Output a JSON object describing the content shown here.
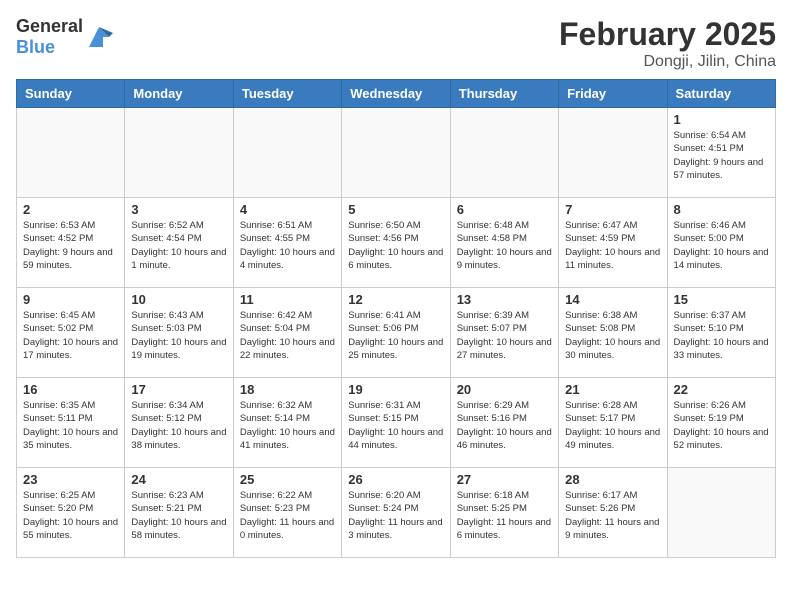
{
  "header": {
    "logo_general": "General",
    "logo_blue": "Blue",
    "title": "February 2025",
    "subtitle": "Dongji, Jilin, China"
  },
  "weekdays": [
    "Sunday",
    "Monday",
    "Tuesday",
    "Wednesday",
    "Thursday",
    "Friday",
    "Saturday"
  ],
  "weeks": [
    [
      {
        "day": "",
        "info": ""
      },
      {
        "day": "",
        "info": ""
      },
      {
        "day": "",
        "info": ""
      },
      {
        "day": "",
        "info": ""
      },
      {
        "day": "",
        "info": ""
      },
      {
        "day": "",
        "info": ""
      },
      {
        "day": "1",
        "info": "Sunrise: 6:54 AM\nSunset: 4:51 PM\nDaylight: 9 hours and 57 minutes."
      }
    ],
    [
      {
        "day": "2",
        "info": "Sunrise: 6:53 AM\nSunset: 4:52 PM\nDaylight: 9 hours and 59 minutes."
      },
      {
        "day": "3",
        "info": "Sunrise: 6:52 AM\nSunset: 4:54 PM\nDaylight: 10 hours and 1 minute."
      },
      {
        "day": "4",
        "info": "Sunrise: 6:51 AM\nSunset: 4:55 PM\nDaylight: 10 hours and 4 minutes."
      },
      {
        "day": "5",
        "info": "Sunrise: 6:50 AM\nSunset: 4:56 PM\nDaylight: 10 hours and 6 minutes."
      },
      {
        "day": "6",
        "info": "Sunrise: 6:48 AM\nSunset: 4:58 PM\nDaylight: 10 hours and 9 minutes."
      },
      {
        "day": "7",
        "info": "Sunrise: 6:47 AM\nSunset: 4:59 PM\nDaylight: 10 hours and 11 minutes."
      },
      {
        "day": "8",
        "info": "Sunrise: 6:46 AM\nSunset: 5:00 PM\nDaylight: 10 hours and 14 minutes."
      }
    ],
    [
      {
        "day": "9",
        "info": "Sunrise: 6:45 AM\nSunset: 5:02 PM\nDaylight: 10 hours and 17 minutes."
      },
      {
        "day": "10",
        "info": "Sunrise: 6:43 AM\nSunset: 5:03 PM\nDaylight: 10 hours and 19 minutes."
      },
      {
        "day": "11",
        "info": "Sunrise: 6:42 AM\nSunset: 5:04 PM\nDaylight: 10 hours and 22 minutes."
      },
      {
        "day": "12",
        "info": "Sunrise: 6:41 AM\nSunset: 5:06 PM\nDaylight: 10 hours and 25 minutes."
      },
      {
        "day": "13",
        "info": "Sunrise: 6:39 AM\nSunset: 5:07 PM\nDaylight: 10 hours and 27 minutes."
      },
      {
        "day": "14",
        "info": "Sunrise: 6:38 AM\nSunset: 5:08 PM\nDaylight: 10 hours and 30 minutes."
      },
      {
        "day": "15",
        "info": "Sunrise: 6:37 AM\nSunset: 5:10 PM\nDaylight: 10 hours and 33 minutes."
      }
    ],
    [
      {
        "day": "16",
        "info": "Sunrise: 6:35 AM\nSunset: 5:11 PM\nDaylight: 10 hours and 35 minutes."
      },
      {
        "day": "17",
        "info": "Sunrise: 6:34 AM\nSunset: 5:12 PM\nDaylight: 10 hours and 38 minutes."
      },
      {
        "day": "18",
        "info": "Sunrise: 6:32 AM\nSunset: 5:14 PM\nDaylight: 10 hours and 41 minutes."
      },
      {
        "day": "19",
        "info": "Sunrise: 6:31 AM\nSunset: 5:15 PM\nDaylight: 10 hours and 44 minutes."
      },
      {
        "day": "20",
        "info": "Sunrise: 6:29 AM\nSunset: 5:16 PM\nDaylight: 10 hours and 46 minutes."
      },
      {
        "day": "21",
        "info": "Sunrise: 6:28 AM\nSunset: 5:17 PM\nDaylight: 10 hours and 49 minutes."
      },
      {
        "day": "22",
        "info": "Sunrise: 6:26 AM\nSunset: 5:19 PM\nDaylight: 10 hours and 52 minutes."
      }
    ],
    [
      {
        "day": "23",
        "info": "Sunrise: 6:25 AM\nSunset: 5:20 PM\nDaylight: 10 hours and 55 minutes."
      },
      {
        "day": "24",
        "info": "Sunrise: 6:23 AM\nSunset: 5:21 PM\nDaylight: 10 hours and 58 minutes."
      },
      {
        "day": "25",
        "info": "Sunrise: 6:22 AM\nSunset: 5:23 PM\nDaylight: 11 hours and 0 minutes."
      },
      {
        "day": "26",
        "info": "Sunrise: 6:20 AM\nSunset: 5:24 PM\nDaylight: 11 hours and 3 minutes."
      },
      {
        "day": "27",
        "info": "Sunrise: 6:18 AM\nSunset: 5:25 PM\nDaylight: 11 hours and 6 minutes."
      },
      {
        "day": "28",
        "info": "Sunrise: 6:17 AM\nSunset: 5:26 PM\nDaylight: 11 hours and 9 minutes."
      },
      {
        "day": "",
        "info": ""
      }
    ]
  ]
}
